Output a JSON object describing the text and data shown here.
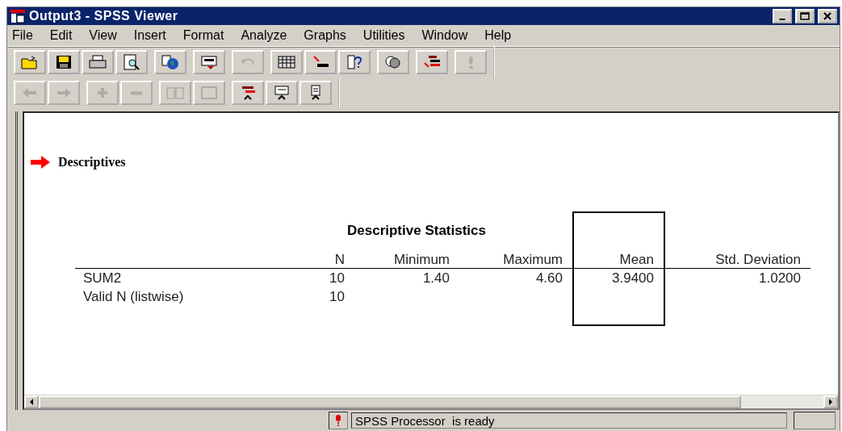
{
  "window": {
    "title": "Output3 - SPSS Viewer"
  },
  "menu": [
    {
      "label": "File"
    },
    {
      "label": "Edit"
    },
    {
      "label": "View"
    },
    {
      "label": "Insert"
    },
    {
      "label": "Format"
    },
    {
      "label": "Analyze"
    },
    {
      "label": "Graphs"
    },
    {
      "label": "Utilities"
    },
    {
      "label": "Window"
    },
    {
      "label": "Help"
    }
  ],
  "toolbars": [
    {
      "groups": [
        [
          {
            "kind": "open",
            "disabled": false
          },
          {
            "kind": "save",
            "disabled": false
          },
          {
            "kind": "print",
            "disabled": false
          },
          {
            "kind": "preview",
            "disabled": false
          }
        ],
        [
          {
            "kind": "export",
            "disabled": false
          }
        ],
        [
          {
            "kind": "dialog",
            "disabled": false
          }
        ],
        [
          {
            "kind": "undo",
            "disabled": true
          }
        ],
        [
          {
            "kind": "grid",
            "disabled": false
          },
          {
            "kind": "goto",
            "disabled": false
          },
          {
            "kind": "info",
            "disabled": false
          }
        ],
        [
          {
            "kind": "sets",
            "disabled": false
          }
        ],
        [
          {
            "kind": "insert",
            "disabled": false
          }
        ],
        [
          {
            "kind": "alert",
            "disabled": true
          }
        ]
      ]
    },
    {
      "groups": [
        [
          {
            "kind": "back",
            "disabled": true
          },
          {
            "kind": "forward",
            "disabled": true
          }
        ],
        [
          {
            "kind": "plus",
            "disabled": true
          },
          {
            "kind": "minus",
            "disabled": true
          }
        ],
        [
          {
            "kind": "book",
            "disabled": true
          },
          {
            "kind": "page",
            "disabled": true
          }
        ],
        [
          {
            "kind": "heading",
            "disabled": false
          },
          {
            "kind": "title",
            "disabled": false
          },
          {
            "kind": "text",
            "disabled": false
          }
        ]
      ]
    }
  ],
  "output": {
    "heading": "Descriptives",
    "table": {
      "title": "Descriptive Statistics",
      "columns": [
        {
          "heading": "N",
          "selected": false
        },
        {
          "heading": "Minimum",
          "selected": false
        },
        {
          "heading": "Maximum",
          "selected": false
        },
        {
          "heading": "Mean",
          "selected": true
        },
        {
          "heading": "Std. Deviation",
          "selected": false
        }
      ],
      "rows": [
        {
          "label": "SUM2",
          "cells": [
            "10",
            "1.40",
            "4.60",
            "3.9400",
            "1.0200"
          ]
        },
        {
          "label": "Valid N (listwise)",
          "cells": [
            "10",
            null,
            null,
            null,
            null
          ]
        }
      ]
    }
  },
  "status_bar": {
    "message": "SPSS Processor  is ready"
  }
}
